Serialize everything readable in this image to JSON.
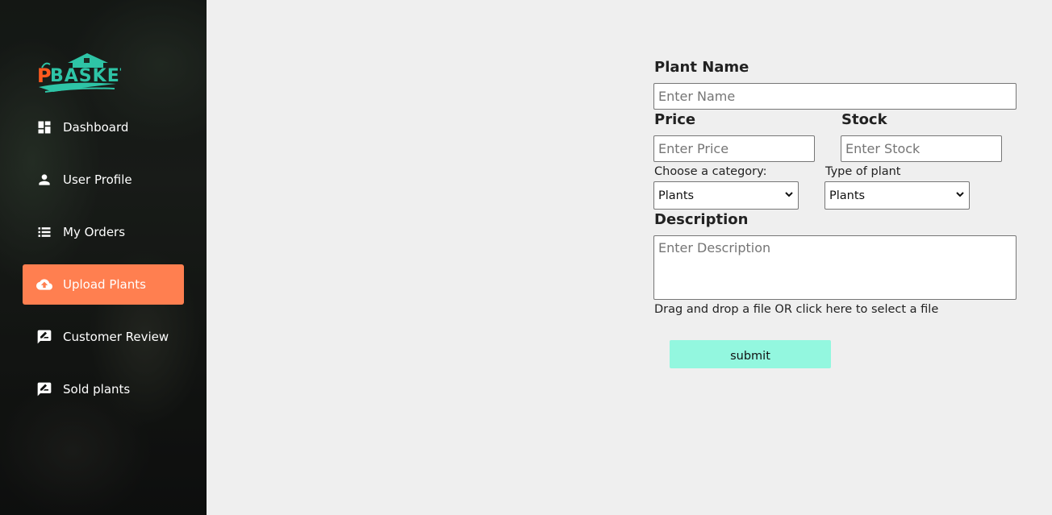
{
  "brand": {
    "logo_text": "PBASKET",
    "colors": {
      "accent_orange": "#ff5a1f",
      "accent_teal": "#2ec4a6"
    }
  },
  "sidebar": {
    "items": [
      {
        "label": "Dashboard",
        "icon": "dashboard-icon",
        "active": false
      },
      {
        "label": "User Profile",
        "icon": "person-icon",
        "active": false
      },
      {
        "label": "My Orders",
        "icon": "list-icon",
        "active": false
      },
      {
        "label": "Upload Plants",
        "icon": "cloud-upload-icon",
        "active": true
      },
      {
        "label": "Customer Review",
        "icon": "rate-review-icon",
        "active": false
      },
      {
        "label": "Sold plants",
        "icon": "rate-review-icon",
        "active": false
      }
    ],
    "active_color": "#ff7f50"
  },
  "form": {
    "plant_name": {
      "label": "Plant Name",
      "placeholder": "Enter Name",
      "value": ""
    },
    "price": {
      "label": "Price",
      "placeholder": "Enter Price",
      "value": ""
    },
    "stock": {
      "label": "Stock",
      "placeholder": "Enter Stock",
      "value": ""
    },
    "category": {
      "label": "Choose a category:",
      "selected": "Plants"
    },
    "plant_type": {
      "label": "Type of plant",
      "selected": "Plants"
    },
    "description": {
      "label": "Description",
      "placeholder": "Enter Description",
      "value": ""
    },
    "dropzone_text": "Drag and drop a file OR click here to select a file",
    "submit_label": "submit",
    "submit_color": "#93f7df"
  }
}
